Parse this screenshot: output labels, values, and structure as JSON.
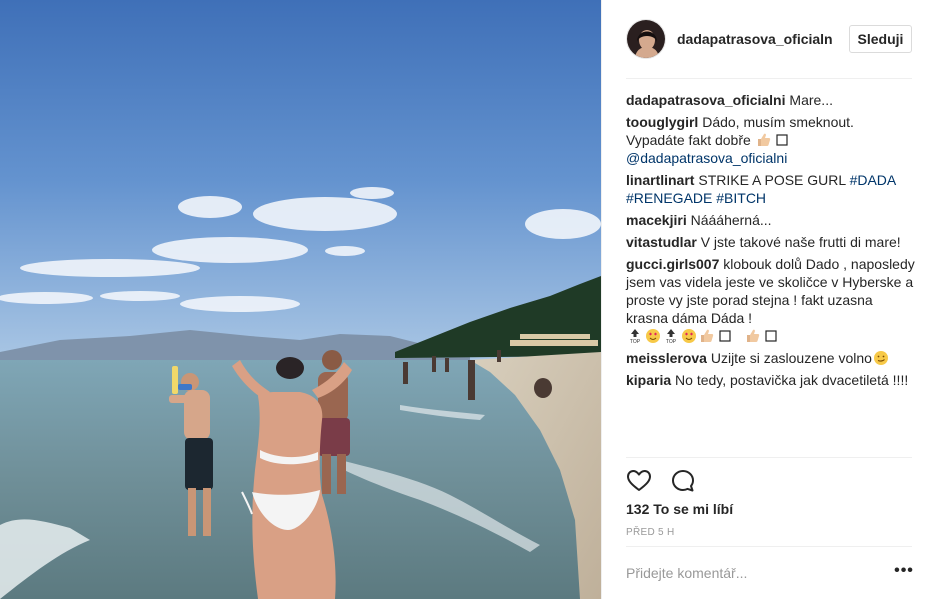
{
  "post": {
    "username": "dadapatrasova_oficialn",
    "follow_label": "Sleduji",
    "caption_user": "dadapatrasova_oficialni",
    "caption_text": " Mare..."
  },
  "comments": [
    {
      "user": "toouglygirl",
      "text": " Dádo, musím smeknout. Vypadáte fakt dobře ",
      "mention": "@dadapatrasova_oficialni"
    },
    {
      "user": "linartlinart",
      "text": " STRIKE A POSE GURL ",
      "tags": [
        "#DADA",
        "#RENEGADE",
        "#BITCH"
      ]
    },
    {
      "user": "macekjiri",
      "text": " Náááherná..."
    },
    {
      "user": "vitastudlar",
      "text": " V jste takové naše frutti di mare!"
    },
    {
      "user": "gucci.girls007",
      "text": " klobouk dolů Dado , naposledy jsem vas videla jeste ve skoličce v Hyberske a proste vy jste porad stejna ! fakt uzasna krasna dáma Dáda ! "
    },
    {
      "user": "meisslerova",
      "text": " Uzijte si zaslouzene volno"
    },
    {
      "user": "kiparia",
      "text": " No tedy, postavička jak dvacetiletá !!!!"
    }
  ],
  "icons": {
    "like": "heart-outline-icon",
    "comment": "speech-bubble-icon",
    "more": "ellipsis-icon"
  },
  "likes_text": "132 To se mi líbí",
  "time_text": "PŘED 5 H",
  "add_comment": {
    "placeholder": "Přidejte komentář..."
  },
  "more_label": "•••",
  "colors": {
    "tag": "#003569",
    "muted": "#999999",
    "text": "#262626",
    "divider": "#efefef"
  }
}
